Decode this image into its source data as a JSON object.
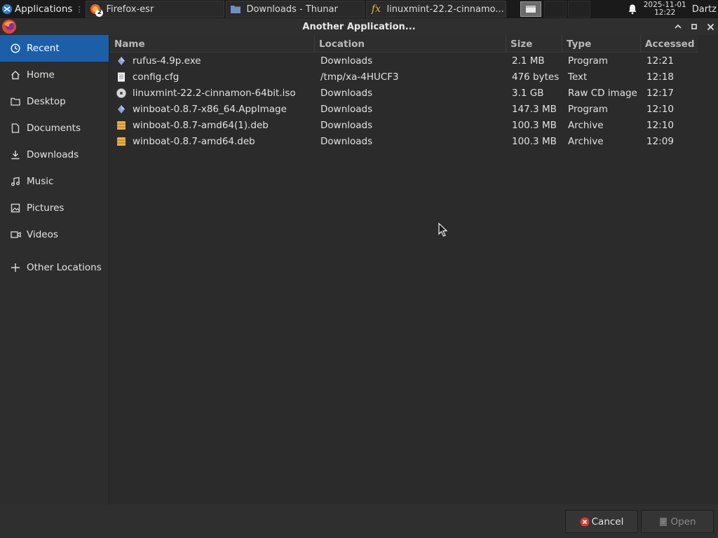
{
  "taskbar": {
    "apps_label": "Applications",
    "tasks": [
      {
        "label": "Firefox-esr",
        "badge": "2"
      },
      {
        "label": "Downloads - Thunar"
      },
      {
        "label": "linuxmint-22.2-cinnamo..."
      }
    ],
    "clock_date": "2025-11-01",
    "clock_time": "12:22",
    "user": "Dartz"
  },
  "dialog": {
    "title": "Another Application..."
  },
  "sidebar": {
    "items": [
      {
        "label": "Recent",
        "icon": "clock-icon",
        "active": true
      },
      {
        "label": "Home",
        "icon": "home-icon"
      },
      {
        "label": "Desktop",
        "icon": "folder-icon"
      },
      {
        "label": "Documents",
        "icon": "document-icon"
      },
      {
        "label": "Downloads",
        "icon": "download-icon"
      },
      {
        "label": "Music",
        "icon": "music-icon"
      },
      {
        "label": "Pictures",
        "icon": "picture-icon"
      },
      {
        "label": "Videos",
        "icon": "video-icon"
      },
      {
        "label": "Other Locations",
        "icon": "plus-icon"
      }
    ]
  },
  "filelist": {
    "columns": [
      "Name",
      "Location",
      "Size",
      "Type",
      "Accessed"
    ],
    "rows": [
      {
        "name": "rufus-4.9p.exe",
        "location": "Downloads",
        "size": "2.1 MB",
        "type": "Program",
        "accessed": "12:21",
        "icon": "program-icon"
      },
      {
        "name": "config.cfg",
        "location": "/tmp/xa-4HUCF3",
        "size": "476 bytes",
        "type": "Text",
        "accessed": "12:18",
        "icon": "text-file-icon"
      },
      {
        "name": "linuxmint-22.2-cinnamon-64bit.iso",
        "location": "Downloads",
        "size": "3.1 GB",
        "type": "Raw CD image",
        "accessed": "12:17",
        "icon": "disc-icon"
      },
      {
        "name": "winboat-0.8.7-x86_64.AppImage",
        "location": "Downloads",
        "size": "147.3 MB",
        "type": "Program",
        "accessed": "12:10",
        "icon": "program-icon"
      },
      {
        "name": "winboat-0.8.7-amd64(1).deb",
        "location": "Downloads",
        "size": "100.3 MB",
        "type": "Archive",
        "accessed": "12:10",
        "icon": "archive-icon"
      },
      {
        "name": "winboat-0.8.7-amd64.deb",
        "location": "Downloads",
        "size": "100.3 MB",
        "type": "Archive",
        "accessed": "12:09",
        "icon": "archive-icon"
      }
    ]
  },
  "footer": {
    "cancel_label": "Cancel",
    "open_label": "Open"
  },
  "colors": {
    "accent": "#1c5fa8",
    "background": "#2b2b2b",
    "cancel_icon": "#d33a32",
    "archive_icon": "#e7b14a",
    "program_icon": "#8f9fd6"
  }
}
